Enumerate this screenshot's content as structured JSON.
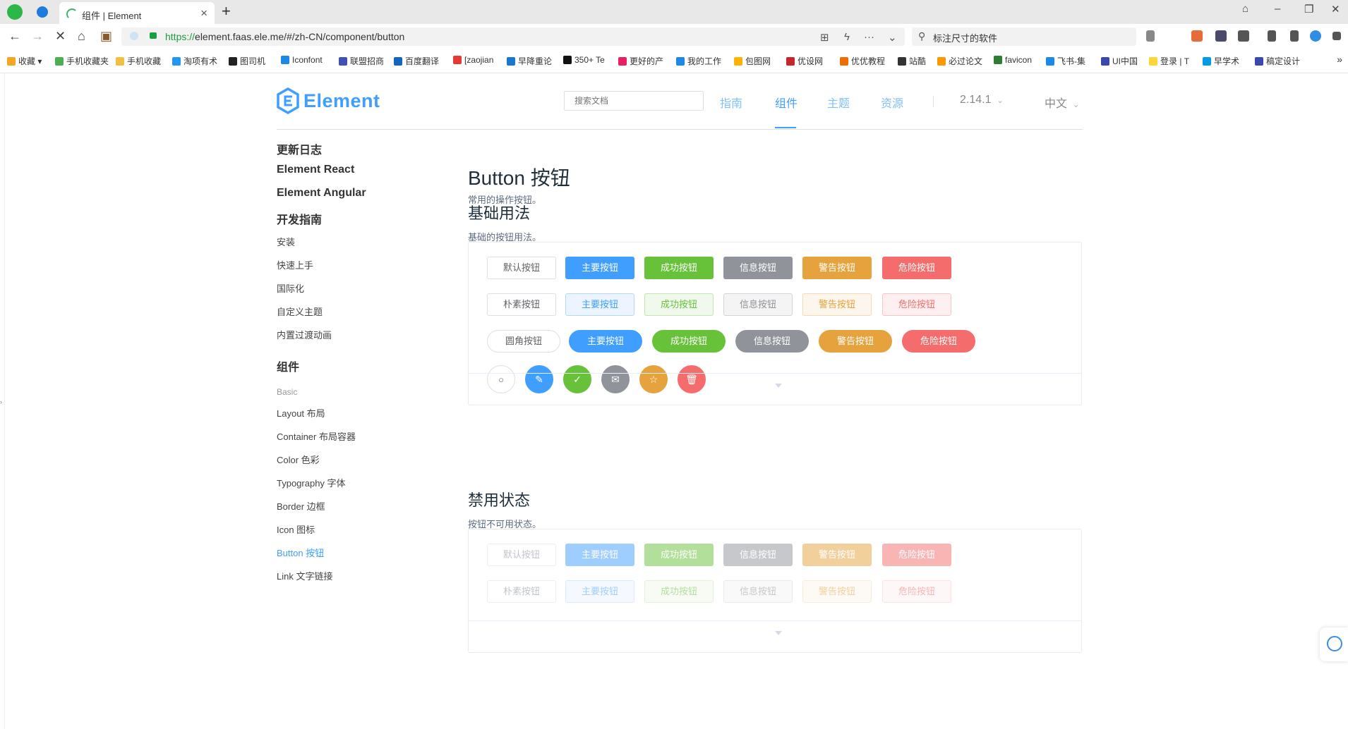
{
  "browser": {
    "tab_title": "组件 | Element",
    "url_scheme": "https://",
    "url_rest": "element.faas.ele.me/#/zh-CN/component/button",
    "search_text": "标注尺寸的软件",
    "bookmarks": [
      "收藏",
      "手机收藏夹",
      "手机收藏",
      "淘项有术",
      "图司机",
      "Iconfont",
      "联盟招商",
      "百度翻译",
      "[zaojian",
      "早降重论",
      "350+ Te",
      "更好的产",
      "我的工作",
      "包图网",
      "优设网",
      "优优教程",
      "站酷",
      "必过论文",
      "favicon",
      "飞书-集",
      "UI中国",
      "登录 | T",
      "早学术",
      "稿定设计"
    ]
  },
  "header": {
    "logo_text": "Element",
    "search_placeholder": "搜索文档",
    "nav": [
      "指南",
      "组件",
      "主题",
      "资源"
    ],
    "version": "2.14.1",
    "language": "中文"
  },
  "sidebar": {
    "top_items": [
      "更新日志",
      "Element React",
      "Element Angular",
      "开发指南"
    ],
    "guide_items": [
      "安装",
      "快速上手",
      "国际化",
      "自定义主题",
      "内置过渡动画"
    ],
    "components_heading": "组件",
    "group_label": "Basic",
    "basic_items": [
      "Layout 布局",
      "Container 布局容器",
      "Color 色彩",
      "Typography 字体",
      "Border 边框",
      "Icon 图标",
      "Button 按钮",
      "Link 文字链接"
    ]
  },
  "content": {
    "title": "Button 按钮",
    "desc": "常用的操作按钮。",
    "basic": {
      "title": "基础用法",
      "desc": "基础的按钮用法。",
      "row_default": [
        "默认按钮",
        "主要按钮",
        "成功按钮",
        "信息按钮",
        "警告按钮",
        "危险按钮"
      ],
      "row_plain": [
        "朴素按钮",
        "主要按钮",
        "成功按钮",
        "信息按钮",
        "警告按钮",
        "危险按钮"
      ],
      "row_round": [
        "圆角按钮",
        "主要按钮",
        "成功按钮",
        "信息按钮",
        "警告按钮",
        "危险按钮"
      ],
      "row_circle_icons": [
        "search-icon",
        "edit-icon",
        "check-icon",
        "message-icon",
        "star-icon",
        "delete-icon"
      ]
    },
    "disabled": {
      "title": "禁用状态",
      "desc": "按钮不可用状态。",
      "row_default": [
        "默认按钮",
        "主要按钮",
        "成功按钮",
        "信息按钮",
        "警告按钮",
        "危险按钮"
      ],
      "row_plain": [
        "朴素按钮",
        "主要按钮",
        "成功按钮",
        "信息按钮",
        "警告按钮",
        "危险按钮"
      ]
    }
  },
  "colors": {
    "primary": "#409EFF",
    "success": "#67C23A",
    "info": "#909399",
    "warning": "#E6A23C",
    "danger": "#F56C6C"
  }
}
